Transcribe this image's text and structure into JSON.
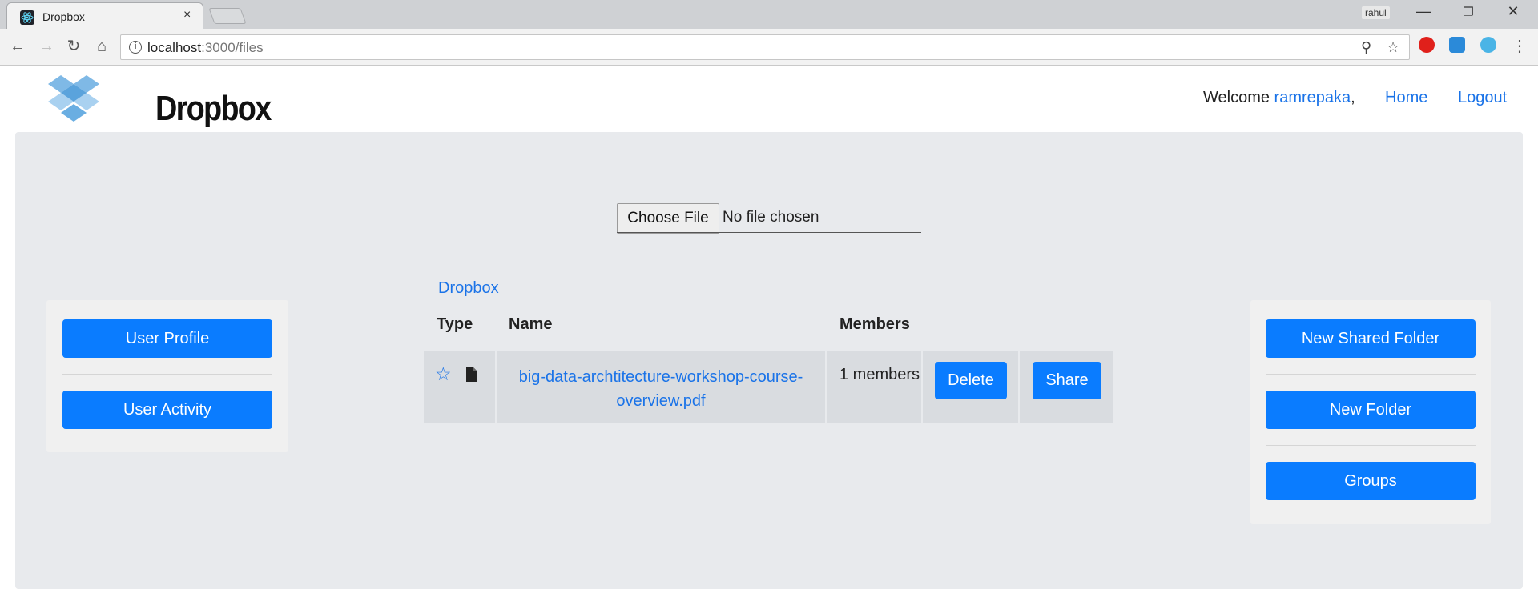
{
  "browser": {
    "tab_title": "Dropbox",
    "tab_close": "×",
    "profile_name": "rahul",
    "url_host": "localhost",
    "url_path": ":3000/files"
  },
  "header": {
    "logo_text": "Dropbox",
    "welcome_prefix": "Welcome ",
    "username": "ramrepaka",
    "welcome_suffix": ",",
    "home_link": "Home",
    "logout_link": "Logout"
  },
  "upload": {
    "choose_button": "Choose File",
    "status": "No file chosen"
  },
  "left_panel": {
    "buttons": [
      "User Profile",
      "User Activity"
    ]
  },
  "right_panel": {
    "buttons": [
      "New Shared Folder",
      "New Folder",
      "Groups"
    ]
  },
  "breadcrumb": "Dropbox",
  "table": {
    "headers": [
      "Type",
      "Name",
      "Members"
    ],
    "rows": [
      {
        "name_line1": "big-data-archtitecture-workshop-course-",
        "name_line2": "overview.pdf",
        "members": "1 members",
        "delete_label": "Delete",
        "share_label": "Share"
      }
    ]
  },
  "colors": {
    "primary": "#0a7cff",
    "link": "#1a73e8",
    "panel": "#e8eaed"
  }
}
